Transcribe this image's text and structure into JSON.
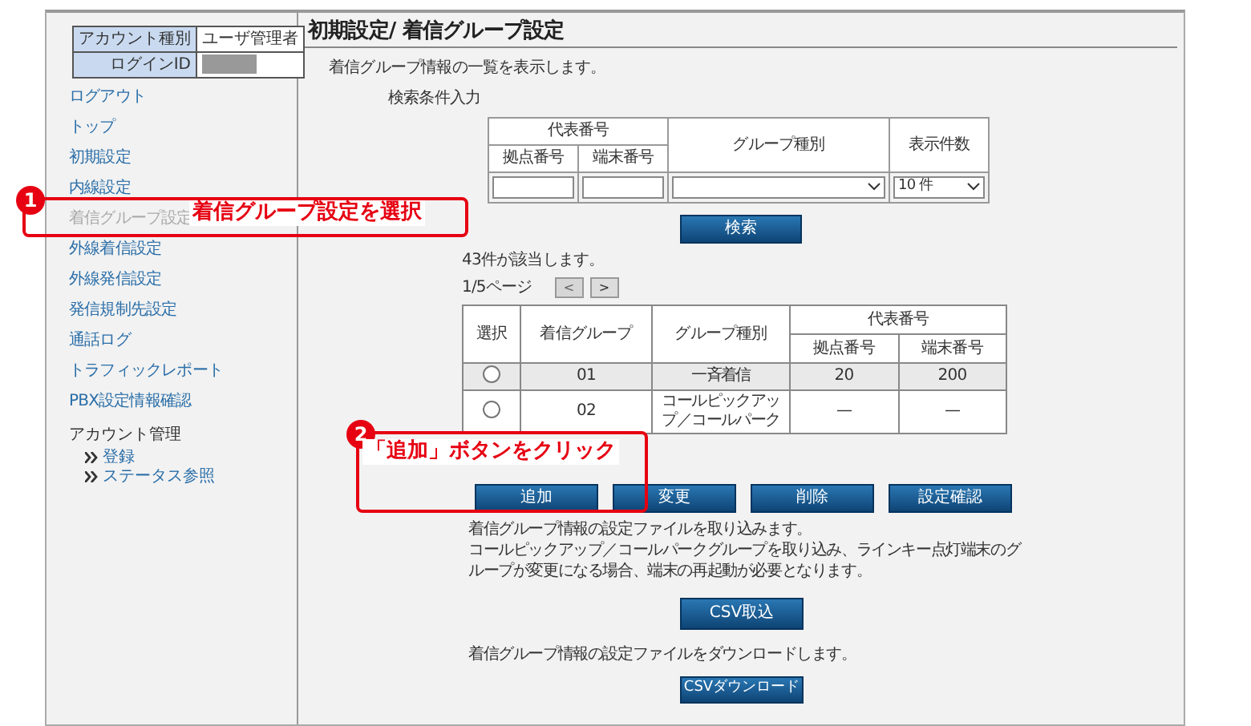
{
  "account": {
    "rows": [
      {
        "label": "アカウント種別",
        "value": "ユーザ管理者"
      },
      {
        "label": "ログインID",
        "masked": true
      }
    ]
  },
  "sidebar": {
    "items": [
      {
        "label": "ログアウト",
        "selected": false
      },
      {
        "label": "トップ",
        "selected": false
      },
      {
        "label": "初期設定",
        "selected": false
      },
      {
        "label": "内線設定",
        "selected": false
      },
      {
        "label": "着信グループ設定",
        "selected": true
      },
      {
        "label": "外線着信設定",
        "selected": false
      },
      {
        "label": "外線発信設定",
        "selected": false
      },
      {
        "label": "発信規制先設定",
        "selected": false
      },
      {
        "label": "通話ログ",
        "selected": false
      },
      {
        "label": "トラフィックレポート",
        "selected": false
      },
      {
        "label": "PBX設定情報確認",
        "selected": false
      }
    ],
    "section": {
      "label": "アカウント管理",
      "children": [
        {
          "label": "登録"
        },
        {
          "label": "ステータス参照"
        }
      ]
    }
  },
  "page": {
    "title": "初期設定/ 着信グループ設定",
    "description": "着信グループ情報の一覧を表示します。",
    "search_heading": "検索条件入力"
  },
  "search_form": {
    "group_header": "代表番号",
    "columns": [
      "拠点番号",
      "端末番号",
      "グループ種別",
      "表示件数"
    ],
    "fields": [
      {
        "kind": "text"
      },
      {
        "kind": "text"
      },
      {
        "kind": "select"
      },
      {
        "kind": "select",
        "value": "10 件"
      }
    ],
    "button": "検索"
  },
  "results": {
    "summary": "43件が該当します。",
    "pager_top": {
      "label": "1/5ページ",
      "prev": {
        "text": "<",
        "disabled": true
      },
      "next": {
        "text": ">",
        "disabled": false
      }
    },
    "columns": [
      "選択",
      "着信グループ",
      "グループ種別"
    ],
    "group_header": "代表番号",
    "sub_columns": [
      "拠点番号",
      "端末番号"
    ],
    "rows": [
      {
        "selected": false,
        "cells": [
          "",
          "01",
          "一斉着信",
          "20",
          "200"
        ]
      },
      {
        "selected": false,
        "cells": [
          "",
          "02",
          "コールピックアップ／コールパーク",
          "—",
          "—"
        ]
      }
    ]
  },
  "actions": [
    "追加",
    "変更",
    "削除",
    "設定確認"
  ],
  "import": {
    "text": [
      "着信グループ情報の設定ファイルを取り込みます。",
      "コールピックアップ／コールパークグループを取り込み、ラインキー点灯端末のグループが変更になる場合、端末の再起動が必要となります。"
    ],
    "button": "CSV取込"
  },
  "export": {
    "text": "着信グループ情報の設定ファイルをダウンロードします。",
    "button": "CSVダウンロード"
  },
  "callouts": [
    {
      "number": "1",
      "text": "着信グループ設定を選択"
    },
    {
      "number": "2",
      "text": "「追加」ボタンをクリック"
    }
  ]
}
